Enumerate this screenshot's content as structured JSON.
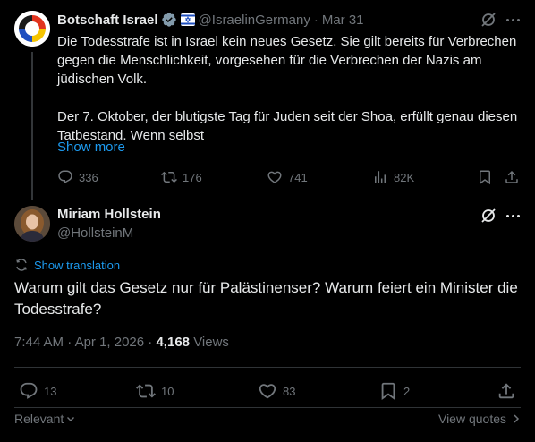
{
  "colors": {
    "background": "#000000",
    "text": "#e7e9ea",
    "muted": "#71767b",
    "link": "#1d9bf0",
    "verified_badge": "#829aab",
    "divider": "#2f3336"
  },
  "parent_tweet": {
    "display_name": "Botschaft Israel",
    "verified_icon": "verified-badge-icon",
    "flag_icon": "israel-flag-icon",
    "handle": "@IsraelinGermany",
    "separator": "·",
    "date": "Mar 31",
    "paragraph_1": "Die Todesstrafe ist in Israel kein neues Gesetz. Sie gilt bereits für Verbrechen gegen die Menschlichkeit, vorgesehen für die Verbrechen der Nazis am jüdischen Volk.",
    "paragraph_2": "Der 7. Oktober, der blutigste Tag für Juden seit der Shoa, erfüllt genau diesen Tatbestand. Wenn selbst",
    "show_more": "Show more",
    "replies": "336",
    "reposts": "176",
    "likes": "741",
    "views": "82K"
  },
  "tweet": {
    "display_name": "Miriam Hollstein",
    "handle": "@HollsteinM",
    "show_translation": "Show translation",
    "text": "Warum gilt das Gesetz nur für Palästinenser? Warum feiert ein Minister die Todesstrafe?",
    "time": "7:44 AM",
    "separator": "·",
    "date": "Apr 1, 2026",
    "meta_separator": "·",
    "views_count": "4,168",
    "views_label": "Views",
    "replies": "13",
    "reposts": "10",
    "likes": "83",
    "bookmarks": "2"
  },
  "footer": {
    "sort_label": "Relevant",
    "view_quotes": "View quotes"
  }
}
